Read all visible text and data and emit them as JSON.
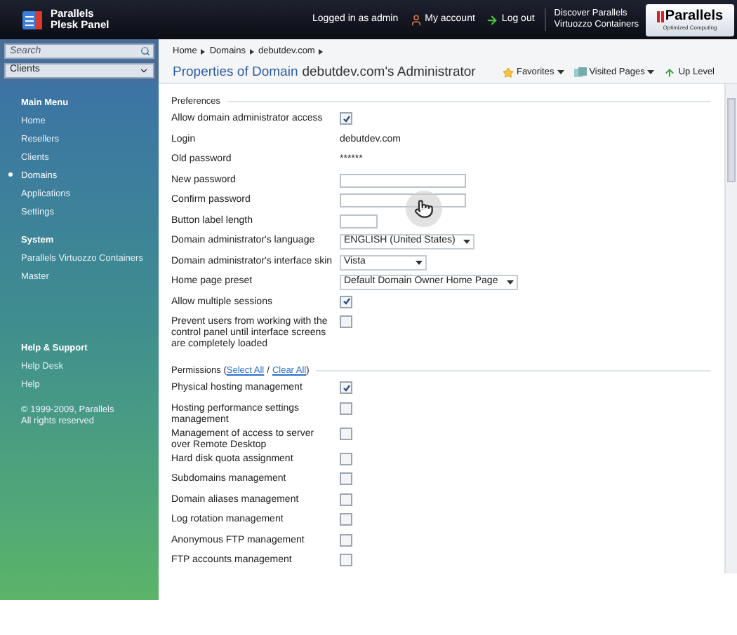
{
  "header": {
    "product_line1": "Parallels",
    "product_line2": "Plesk Panel",
    "logged_in": "Logged in as admin",
    "my_account": "My account",
    "log_out": "Log out",
    "discover_line1": "Discover Parallels",
    "discover_line2": "Virtuozzo Containers",
    "brand": "Parallels",
    "brand_tagline": "Optimized Computing"
  },
  "sidebar": {
    "search": {
      "placeholder": "Search"
    },
    "context_select": "Clients",
    "sections": [
      {
        "title": "Main Menu",
        "items": [
          {
            "label": "Home",
            "selected": false
          },
          {
            "label": "Resellers",
            "selected": false
          },
          {
            "label": "Clients",
            "selected": false
          },
          {
            "label": "Domains",
            "selected": true
          },
          {
            "label": "Applications",
            "selected": false
          },
          {
            "label": "Settings",
            "selected": false
          }
        ]
      },
      {
        "title": "System",
        "items": [
          {
            "label": "Parallels Virtuozzo Containers",
            "selected": false
          },
          {
            "label": "Master",
            "selected": false
          }
        ]
      },
      {
        "title": "Help & Support",
        "items": [
          {
            "label": "Help Desk",
            "selected": false
          },
          {
            "label": "Help",
            "selected": false
          }
        ]
      }
    ],
    "copyright_line1": "© 1999-2009, Parallels",
    "copyright_line2": "All rights reserved"
  },
  "breadcrumb": [
    "Home",
    "Domains",
    "debutdev.com"
  ],
  "title": {
    "prefix": "Properties of Domain",
    "subject": "debutdev.com's Administrator"
  },
  "toolbar": [
    "Favorites",
    "Visited Pages",
    "Up Level"
  ],
  "preferences": {
    "title": "Preferences",
    "rows": [
      {
        "kind": "checkbox",
        "label": "Allow domain administrator access",
        "checked": true
      },
      {
        "kind": "text",
        "label": "Login",
        "value": "debutdev.com"
      },
      {
        "kind": "text",
        "label": "Old password",
        "value": "******"
      },
      {
        "kind": "input_wide",
        "label": "New password"
      },
      {
        "kind": "input_wide",
        "label": "Confirm password"
      },
      {
        "kind": "input_short",
        "label": "Button label length"
      },
      {
        "kind": "select",
        "label": "Domain administrator's language",
        "value": "ENGLISH (United States)"
      },
      {
        "kind": "select",
        "label": "Domain administrator's interface skin",
        "value": "Vista"
      },
      {
        "kind": "select",
        "label": "Home page preset",
        "value": "Default Domain Owner Home Page"
      },
      {
        "kind": "checkbox",
        "label": "Allow multiple sessions",
        "checked": true
      },
      {
        "kind": "checkbox",
        "label": "Prevent users from working with the control panel until interface screens are completely loaded",
        "checked": false
      }
    ]
  },
  "permissions": {
    "title": "Permissions (",
    "select_all": "Select All",
    "separator": "/",
    "clear_all": "Clear All",
    "close": ")",
    "rows": [
      {
        "label": "Physical hosting management",
        "checked": true
      },
      {
        "label": "Hosting performance settings management",
        "checked": false
      },
      {
        "label": "Management of access to server over Remote Desktop",
        "checked": false
      },
      {
        "label": "Hard disk quota assignment",
        "checked": false
      },
      {
        "label": "Subdomains management",
        "checked": false
      },
      {
        "label": "Domain aliases management",
        "checked": false
      },
      {
        "label": "Log rotation management",
        "checked": false
      },
      {
        "label": "Anonymous FTP management",
        "checked": false
      },
      {
        "label": "FTP accounts management",
        "checked": false
      }
    ]
  }
}
